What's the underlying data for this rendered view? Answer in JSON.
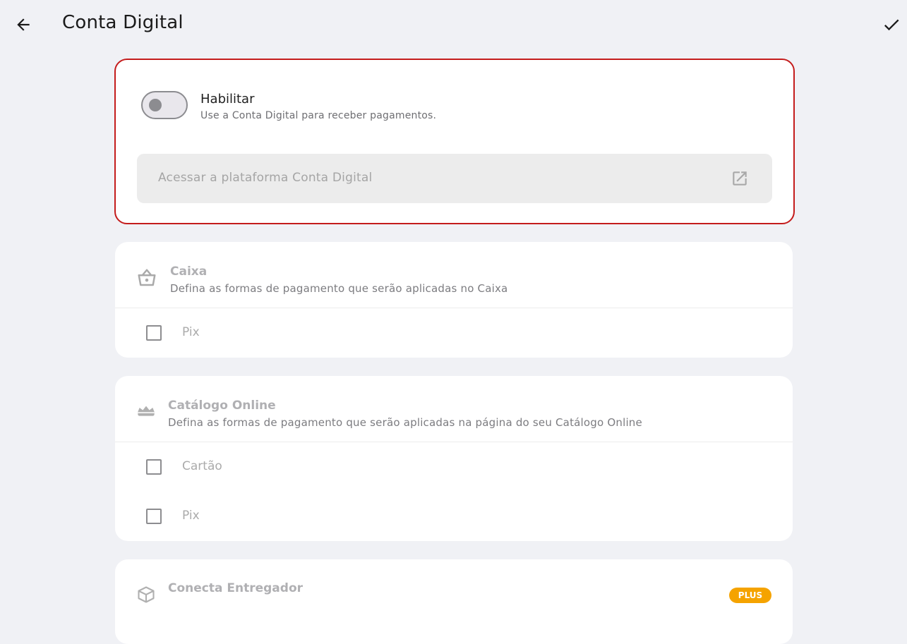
{
  "header": {
    "title": "Conta Digital",
    "back_icon": "arrow-left-icon",
    "confirm_icon": "check-icon"
  },
  "enable_card": {
    "toggle_on": false,
    "title": "Habilitar",
    "subtitle": "Use a Conta Digital para receber pagamentos.",
    "platform_button_label": "Acessar a plataforma Conta Digital",
    "platform_icon": "open-in-new-icon",
    "border_color": "#c41c1c"
  },
  "caixa": {
    "icon": "basket-icon",
    "title": "Caixa",
    "subtitle": "Defina as formas de pagamento que serão aplicadas no Caixa",
    "options": [
      {
        "label": "Pix",
        "checked": false
      }
    ]
  },
  "catalogo": {
    "icon": "storefront-icon",
    "title": "Catálogo Online",
    "subtitle": "Defina as formas de pagamento que serão aplicadas na página do seu Catálogo Online",
    "options": [
      {
        "label": "Cartão",
        "checked": false
      },
      {
        "label": "Pix",
        "checked": false
      }
    ]
  },
  "entregador": {
    "icon": "package-icon",
    "title": "Conecta Entregador",
    "badge": "PLUS",
    "badge_color": "#f5a300"
  }
}
